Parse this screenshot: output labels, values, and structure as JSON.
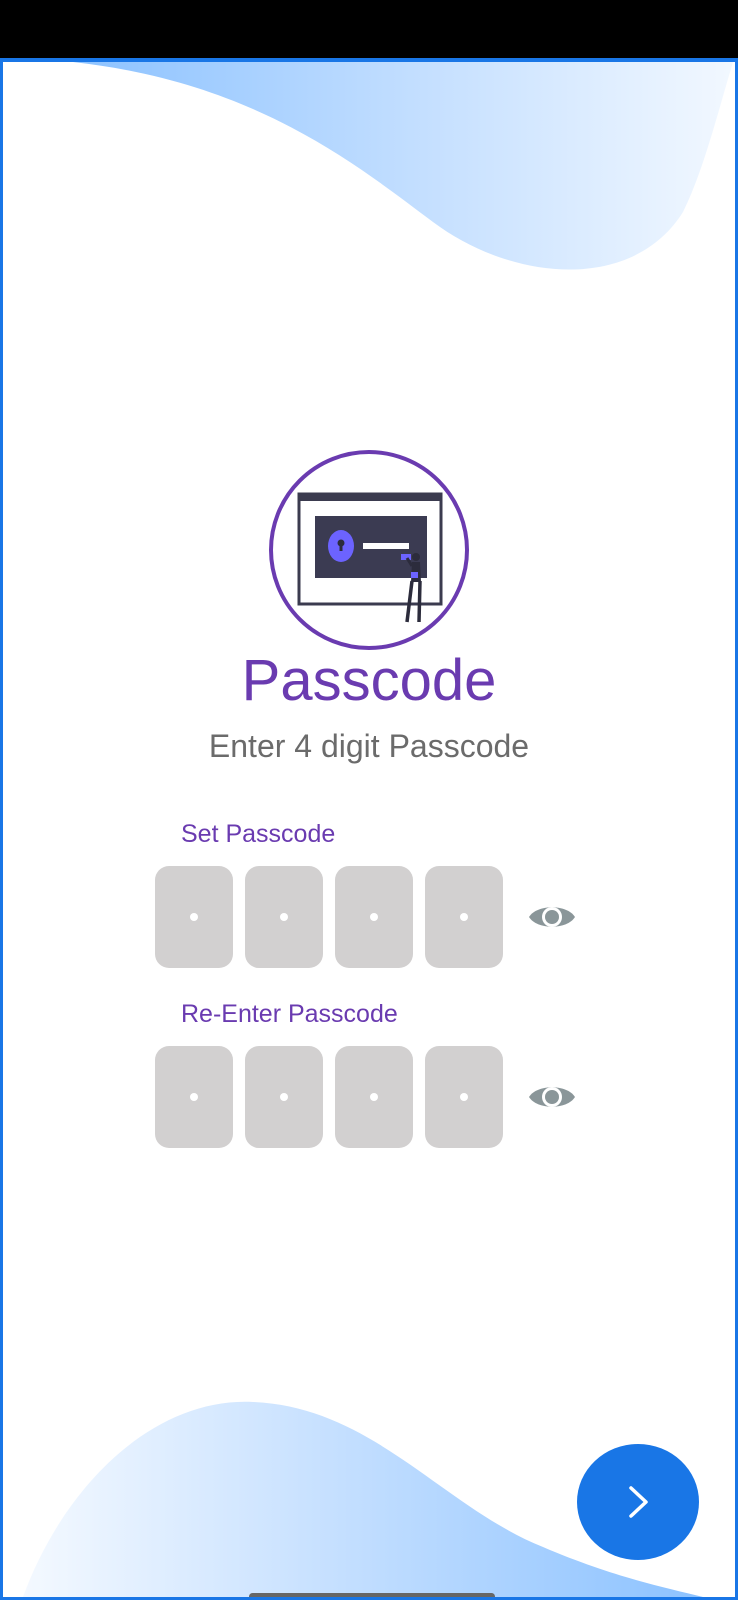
{
  "header": {
    "title": "Passcode",
    "subtitle": "Enter 4 digit Passcode"
  },
  "set_passcode": {
    "label": "Set Passcode",
    "digits": [
      "",
      "",
      "",
      ""
    ],
    "visibility_icon": "eye-icon"
  },
  "reenter_passcode": {
    "label": "Re-Enter Passcode",
    "digits": [
      "",
      "",
      "",
      ""
    ],
    "visibility_icon": "eye-icon"
  },
  "next_button": {
    "icon": "chevron-right-icon"
  },
  "illustration": {
    "icon": "lock-screen-illustration"
  },
  "colors": {
    "accent": "#6a3bb0",
    "primary": "#1976e6",
    "pin_box": "#d2d0d0",
    "eye": "#8a9699",
    "subtitle": "#6b6b6b"
  }
}
